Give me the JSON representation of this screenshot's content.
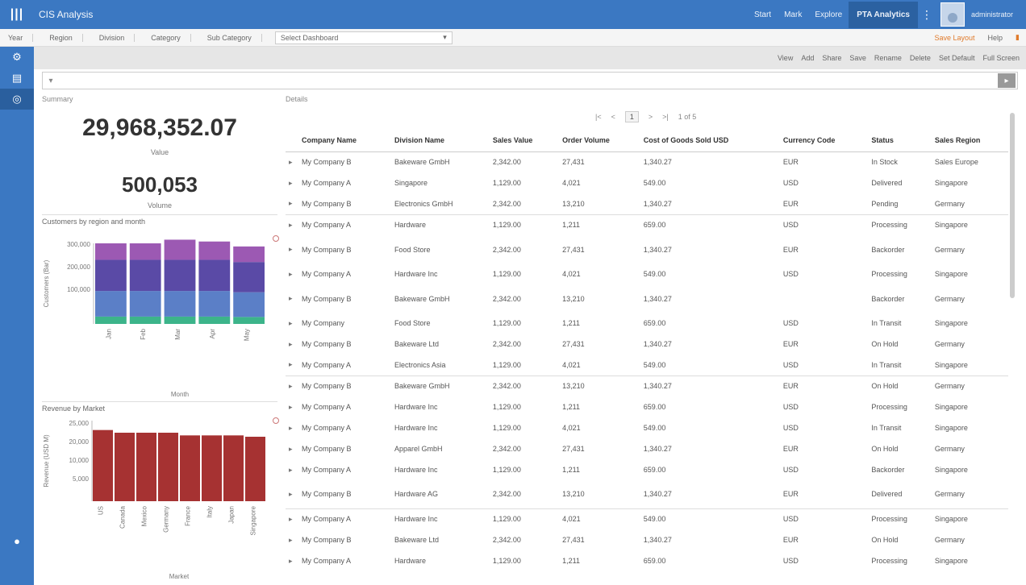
{
  "app": {
    "title": "CIS Analysis"
  },
  "topnav": {
    "links": [
      "Start",
      "Mark",
      "Explore",
      "PTA Analytics"
    ],
    "user_name": "administrator"
  },
  "filters": {
    "items": [
      "Year",
      "Region",
      "Division",
      "Category",
      "Sub Category"
    ],
    "select_value": "Select Dashboard",
    "right_items": [
      "Save Layout",
      "Help"
    ]
  },
  "subbar": {
    "items": [
      "View",
      "Add",
      "Share",
      "Save",
      "Rename",
      "Delete",
      "Set Default",
      "Full Screen"
    ]
  },
  "search": {
    "placeholder": "",
    "value": ""
  },
  "left": {
    "title": "Summary",
    "kpi1": {
      "value": "29,968,352.07",
      "caption": "Value"
    },
    "kpi2": {
      "value": "500,053",
      "caption": "Volume"
    },
    "chart1": {
      "title": "Customers by region and month",
      "xlabel": "Month",
      "ylabel": "Customers (Bar)"
    },
    "chart2": {
      "title": "Revenue by Market",
      "xlabel": "Market",
      "ylabel": "Revenue (USD M)"
    }
  },
  "right": {
    "title": "Details",
    "pager": {
      "first": "|<",
      "prev": "<",
      "current": "1",
      "next": ">",
      "last": ">|",
      "page_info": "1 of 5"
    },
    "columns": [
      "Company Name",
      "Division Name",
      "Sales Value",
      "Order Volume",
      "Cost of Goods Sold USD",
      "Currency Code",
      "Status",
      "Sales Region"
    ],
    "rows": [
      [
        "My Company B",
        "Bakeware GmbH",
        "2,342.00",
        "27,431",
        "1,340.27",
        "EUR",
        "In Stock",
        "Sales Europe"
      ],
      [
        "My Company A",
        "Singapore",
        "1,129.00",
        "4,021",
        "549.00",
        "USD",
        "Delivered",
        "Singapore"
      ],
      [
        "My Company B",
        "Electronics GmbH",
        "2,342.00",
        "13,210",
        "1,340.27",
        "EUR",
        "Pending",
        "Germany"
      ],
      [
        "My Company A",
        "Hardware",
        "1,129.00",
        "1,211",
        "659.00",
        "USD",
        "Processing",
        "Singapore"
      ],
      [
        "My Company B",
        "Food Store",
        "2,342.00",
        "27,431",
        "1,340.27",
        "EUR",
        "Backorder",
        "Germany"
      ],
      [
        "My Company A",
        "Hardware Inc",
        "1,129.00",
        "4,021",
        "549.00",
        "USD",
        "Processing",
        "Singapore"
      ],
      [
        "My Company B",
        "Bakeware GmbH",
        "2,342.00",
        "13,210",
        "1,340.27",
        "",
        "Backorder",
        "Germany"
      ],
      [
        "My Company",
        "Food Store",
        "1,129.00",
        "1,211",
        "659.00",
        "USD",
        "In Transit",
        "Singapore"
      ],
      [
        "My Company B",
        "Bakeware Ltd",
        "2,342.00",
        "27,431",
        "1,340.27",
        "EUR",
        "On Hold",
        "Germany"
      ],
      [
        "My Company A",
        "Electronics Asia",
        "1,129.00",
        "4,021",
        "549.00",
        "USD",
        "In Transit",
        "Singapore"
      ],
      [
        "My Company B",
        "Bakeware GmbH",
        "2,342.00",
        "13,210",
        "1,340.27",
        "EUR",
        "On Hold",
        "Germany"
      ],
      [
        "My Company A",
        "Hardware Inc",
        "1,129.00",
        "1,211",
        "659.00",
        "USD",
        "Processing",
        "Singapore"
      ],
      [
        "My Company A",
        "Hardware Inc",
        "1,129.00",
        "4,021",
        "549.00",
        "USD",
        "In Transit",
        "Singapore"
      ],
      [
        "My Company B",
        "Apparel GmbH",
        "2,342.00",
        "27,431",
        "1,340.27",
        "EUR",
        "On Hold",
        "Germany"
      ],
      [
        "My Company A",
        "Hardware Inc",
        "1,129.00",
        "1,211",
        "659.00",
        "USD",
        "Backorder",
        "Singapore"
      ],
      [
        "My Company B",
        "Hardware AG",
        "2,342.00",
        "13,210",
        "1,340.27",
        "EUR",
        "Delivered",
        "Germany"
      ],
      [
        "My Company A",
        "Hardware Inc",
        "1,129.00",
        "4,021",
        "549.00",
        "USD",
        "Processing",
        "Singapore"
      ],
      [
        "My Company B",
        "Bakeware Ltd",
        "2,342.00",
        "27,431",
        "1,340.27",
        "EUR",
        "On Hold",
        "Germany"
      ],
      [
        "My Company A",
        "Hardware",
        "1,129.00",
        "1,211",
        "659.00",
        "USD",
        "Processing",
        "Singapore"
      ]
    ]
  },
  "chart_data": [
    {
      "type": "bar",
      "stacked": true,
      "categories": [
        "Jan",
        "Feb",
        "Mar",
        "Apr",
        "May"
      ],
      "series": [
        {
          "values": [
            40000,
            40000,
            40000,
            40000,
            38000
          ],
          "color": "#3cb48a"
        },
        {
          "values": [
            140000,
            140000,
            140000,
            140000,
            135000
          ],
          "color": "#5b7fc7"
        },
        {
          "values": [
            170000,
            170000,
            170000,
            170000,
            165000
          ],
          "color": "#5a4aa6"
        },
        {
          "values": [
            90000,
            90000,
            110000,
            100000,
            85000
          ],
          "color": "#9c59b3"
        }
      ],
      "ylim": [
        0,
        440000
      ],
      "yticks": [
        "300,000",
        "200,000",
        "100,000"
      ]
    },
    {
      "type": "bar",
      "categories": [
        "US",
        "Canada",
        "Mexico",
        "Germany",
        "France",
        "Italy",
        "Japan",
        "Singapore"
      ],
      "values": [
        26.5,
        25.5,
        25.5,
        25.5,
        24.5,
        24.5,
        24.5,
        24.0
      ],
      "ylim": [
        0,
        30
      ],
      "yticks": [
        "25,000",
        "20,000",
        "10,000",
        "5,000"
      ],
      "color": "#a63232"
    }
  ]
}
